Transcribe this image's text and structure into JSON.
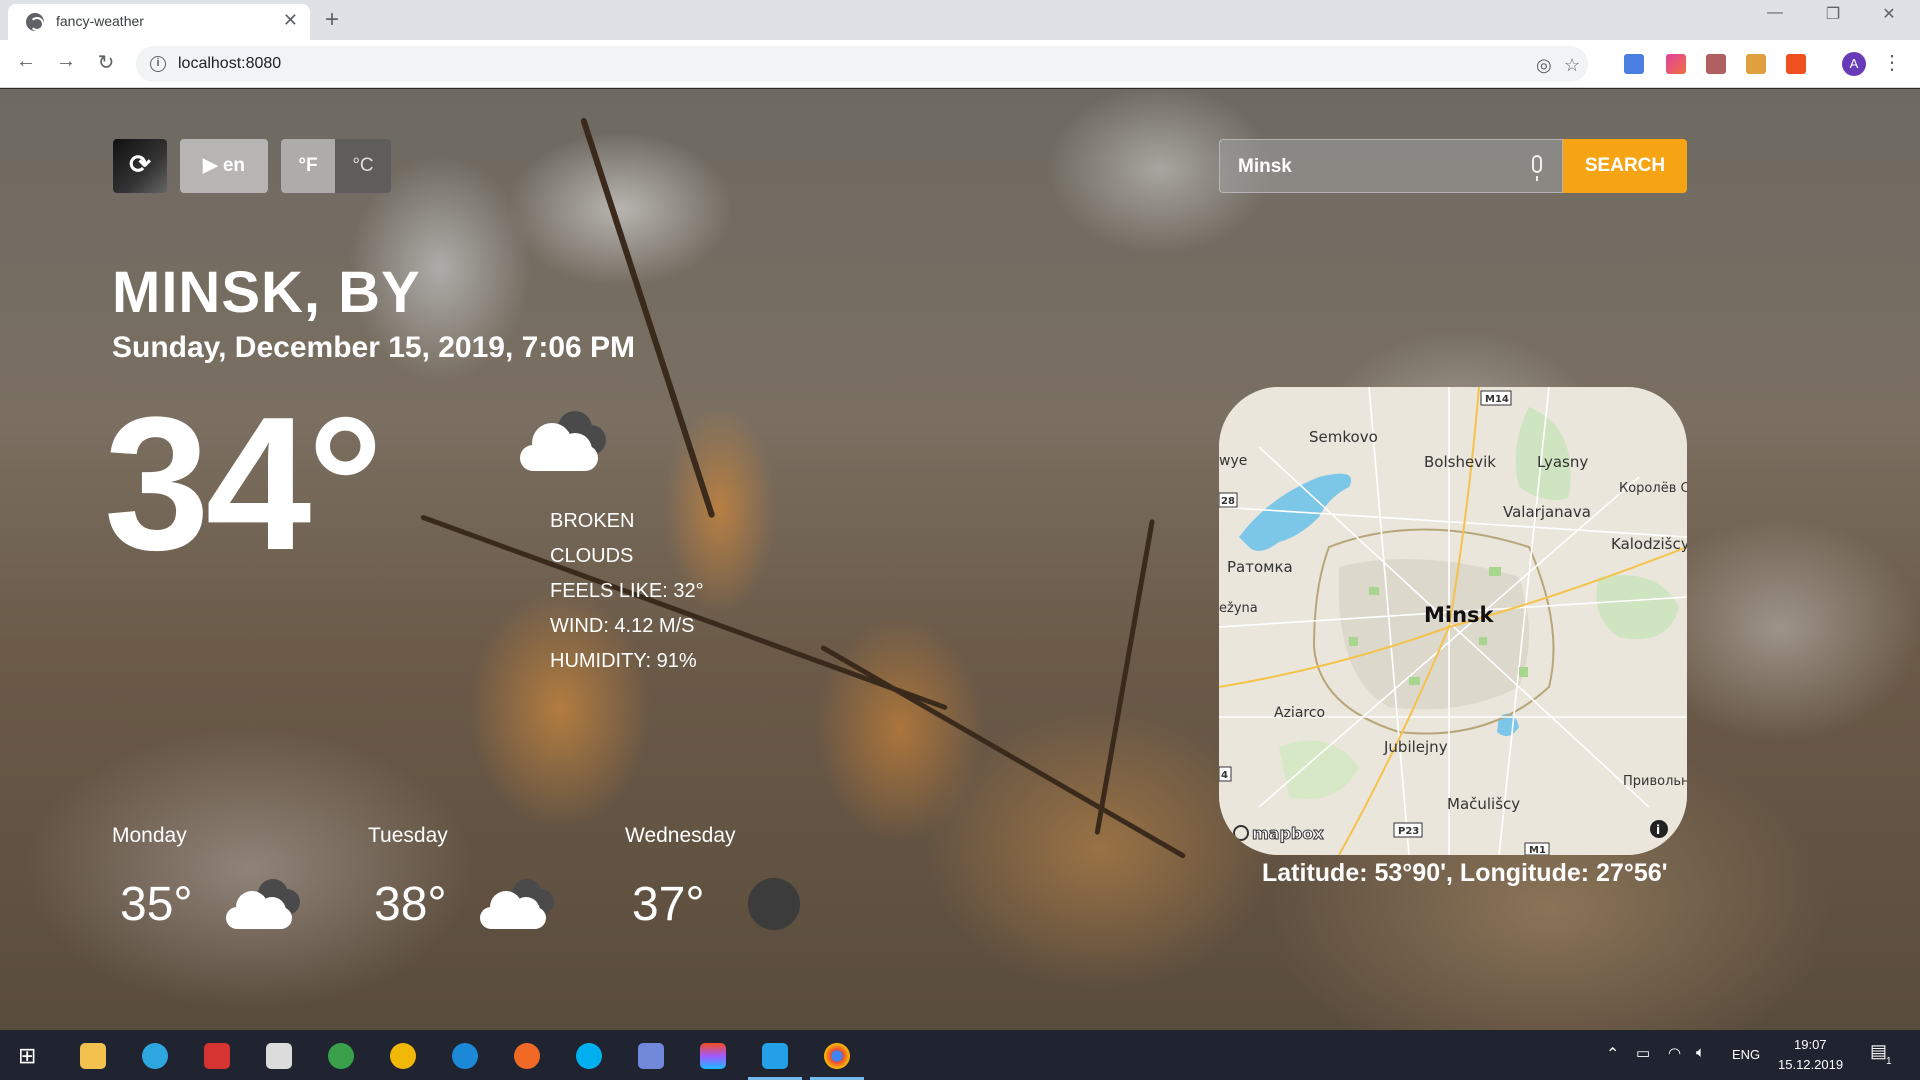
{
  "browser": {
    "tab_title": "fancy-weather",
    "url": "localhost:8080",
    "avatar_letter": "A"
  },
  "controls": {
    "language": "en",
    "unit_f": "°F",
    "unit_c": "°C",
    "active_unit": "°C"
  },
  "search": {
    "value": "Minsk",
    "button_label": "SEARCH"
  },
  "weather": {
    "location": "MINSK, BY",
    "datetime": "Sunday, December 15, 2019, 7:06 PM",
    "temperature": "34°",
    "description_line1": "BROKEN",
    "description_line2": "CLOUDS",
    "feels_like": "FEELS LIKE: 32°",
    "wind": "WIND: 4.12 m/s",
    "humidity": "HUMIDITY: 91%",
    "icon": "broken-clouds-icon"
  },
  "map": {
    "labels": [
      "Semkovo",
      "Bolshevik",
      "Lyasny",
      "Королёв С",
      "Valarjanava",
      "Ратомка",
      "Kalodzišcy",
      "Minsk",
      "Aziarco",
      "Jubilejny",
      "Привольн",
      "Mačulišcy",
      "ežyna",
      "wye"
    ],
    "road_labels": [
      "M14",
      "28",
      "4",
      "P23",
      "M1"
    ],
    "attribution": "mapbox",
    "coordinates": "Latitude: 53°90', Longitude: 27°56'"
  },
  "forecast": [
    {
      "day": "Monday",
      "temp": "35°",
      "icon": "broken-clouds-icon"
    },
    {
      "day": "Tuesday",
      "temp": "38°",
      "icon": "broken-clouds-icon"
    },
    {
      "day": "Wednesday",
      "temp": "37°",
      "icon": "moon-icon"
    }
  ],
  "taskbar": {
    "language": "ENG",
    "time": "19:07",
    "date": "15.12.2019",
    "notifications": "1"
  },
  "colors": {
    "search_button": "#f7a414",
    "text": "#ffffff",
    "taskbar": "#1f2430"
  }
}
